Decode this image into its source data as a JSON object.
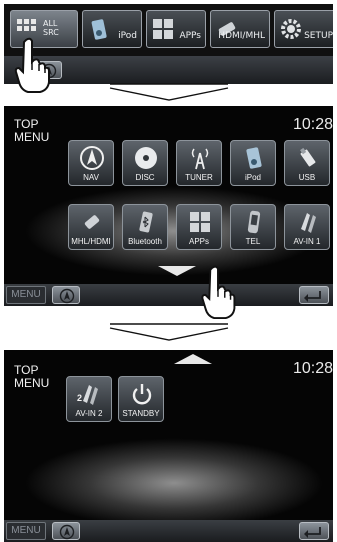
{
  "panel1": {
    "sources": [
      {
        "label": "ALL SRC",
        "line1": "ALL",
        "line2": "SRC",
        "icon": "grid-icon"
      },
      {
        "label": "iPod",
        "icon": "ipod-icon"
      },
      {
        "label": "APPs",
        "icon": "apps-icon"
      },
      {
        "label": "HDMI/MHL",
        "icon": "hdmi-icon"
      },
      {
        "label": "SETUP",
        "icon": "gear-icon"
      }
    ]
  },
  "panel2": {
    "title_line1": "TOP",
    "title_line2": "MENU",
    "clock": "10:28",
    "row1": [
      {
        "label": "NAV",
        "icon": "compass-icon"
      },
      {
        "label": "DISC",
        "icon": "disc-icon"
      },
      {
        "label": "TUNER",
        "icon": "antenna-icon"
      },
      {
        "label": "iPod",
        "icon": "ipod-icon"
      },
      {
        "label": "USB",
        "icon": "usb-icon"
      }
    ],
    "row2": [
      {
        "label": "MHL/HDMI",
        "icon": "hdmi-icon"
      },
      {
        "label": "Bluetooth",
        "icon": "phone-icon"
      },
      {
        "label": "APPs",
        "icon": "apps-icon"
      },
      {
        "label": "TEL",
        "icon": "handset-icon"
      },
      {
        "label": "AV-IN 1",
        "icon": "av-input-icon"
      }
    ],
    "menu_label": "MENU"
  },
  "panel3": {
    "title_line1": "TOP",
    "title_line2": "MENU",
    "clock": "10:28",
    "tiles": [
      {
        "label": "AV-IN 2",
        "icon": "av-input-icon",
        "badge": "2"
      },
      {
        "label": "STANDBY",
        "icon": "power-icon"
      }
    ],
    "menu_label": "MENU"
  },
  "colors": {
    "panel_bg": "#050505",
    "tile_border": "#8d949b",
    "text": "#f4f4f4",
    "button_grey": "#8c939b"
  }
}
